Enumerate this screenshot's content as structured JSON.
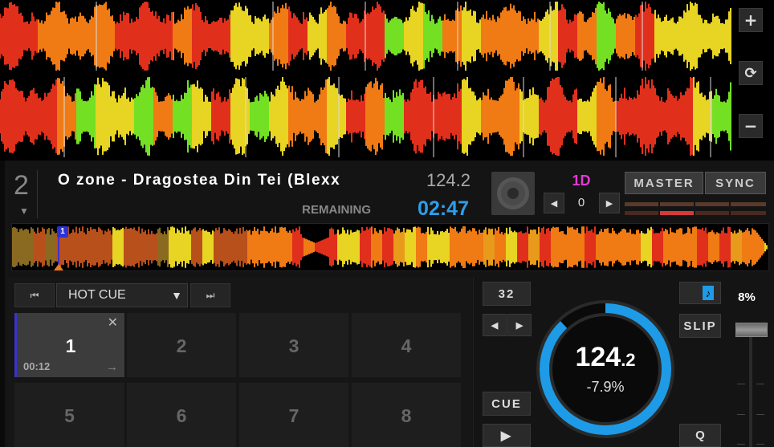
{
  "zoom_controls": {
    "zoom_in_label": "+",
    "reset_label": "⟳",
    "zoom_out_label": "−"
  },
  "deck": {
    "number": "2",
    "expand_arrow": "▼",
    "track_title": "O zone - Dragostea Din Tei (Blexx",
    "bpm": "124.2",
    "time_label": "REMAINING",
    "time": "02:47",
    "key": "1D",
    "key_adjust": "0",
    "key_down_label": "◀",
    "key_up_label": "▶",
    "master_label": "MASTER",
    "sync_label": "SYNC"
  },
  "overview": {
    "marker_label": "1"
  },
  "cue_panel": {
    "prev_label": "⏮",
    "next_label": "⏭",
    "mode": "HOT CUE",
    "mode_chevron": "▼",
    "pads": [
      {
        "label": "1",
        "time": "00:12",
        "active": true
      },
      {
        "label": "2"
      },
      {
        "label": "3"
      },
      {
        "label": "4"
      },
      {
        "label": "5"
      },
      {
        "label": "6"
      },
      {
        "label": "7"
      },
      {
        "label": "8"
      }
    ],
    "clear_icon": "✕",
    "jump_icon": "→"
  },
  "transport": {
    "loop_size": "32",
    "loop_back_label": "◀",
    "loop_fwd_label": "▶",
    "cue_label": "CUE",
    "play_label": "▶",
    "slip_label": "SLIP",
    "quantize_label": "Q",
    "keylock_icon": "♪",
    "platter_bpm_int": "124",
    "platter_bpm_dec": ".2",
    "platter_pitch": "-7.9%",
    "pitch_range": "8%",
    "platter_progress": 0.88
  },
  "colors": {
    "accent_blue": "#1e9be6",
    "key_magenta": "#e23ad6",
    "hotcue_blue": "#3a34c8",
    "waveform_red": "#e0301c",
    "waveform_orange": "#f07a14",
    "waveform_yellow": "#e8d422",
    "waveform_green": "#74e024"
  }
}
